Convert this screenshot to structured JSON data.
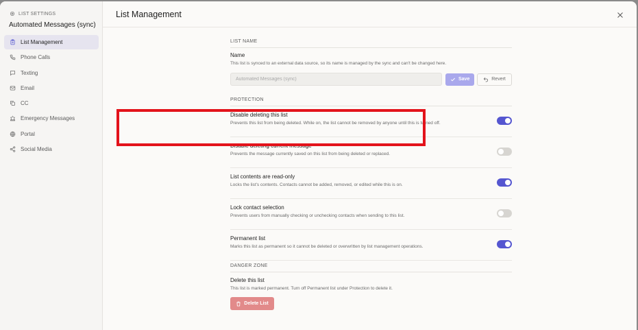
{
  "sidebar": {
    "eyebrow": "LIST SETTINGS",
    "title": "Automated Messages (sync)",
    "items": [
      {
        "label": "List Management",
        "icon": "list-clipboard-icon",
        "active": true
      },
      {
        "label": "Phone Calls",
        "icon": "phone-icon"
      },
      {
        "label": "Texting",
        "icon": "message-icon"
      },
      {
        "label": "Email",
        "icon": "mail-icon"
      },
      {
        "label": "CC",
        "icon": "copy-icon"
      },
      {
        "label": "Emergency Messages",
        "icon": "siren-icon"
      },
      {
        "label": "Portal",
        "icon": "globe-icon"
      },
      {
        "label": "Social Media",
        "icon": "share-icon"
      }
    ]
  },
  "header": {
    "title": "List Management"
  },
  "list_name": {
    "section": "LIST NAME",
    "title": "Name",
    "desc": "This list is synced to an external data source, so its name is managed by the sync and can't be changed here.",
    "input_value": "Automated Messages (sync)",
    "save_label": "Save",
    "revert_label": "Revert"
  },
  "protection": {
    "section": "PROTECTION",
    "rows": [
      {
        "title": "Disable deleting this list",
        "desc": "Prevents this list from being deleted. While on, the list cannot be removed by anyone until this is turned off.",
        "on": true
      },
      {
        "title": "Disable deleting current message",
        "desc": "Prevents the message currently saved on this list from being deleted or replaced.",
        "on": false
      },
      {
        "title": "List contents are read-only",
        "desc": "Locks the list's contents. Contacts cannot be added, removed, or edited while this is on.",
        "on": true
      },
      {
        "title": "Lock contact selection",
        "desc": "Prevents users from manually checking or unchecking contacts when sending to this list.",
        "on": false
      },
      {
        "title": "Permanent list",
        "desc": "Marks this list as permanent so it cannot be deleted or overwritten by list management operations.",
        "on": true
      }
    ]
  },
  "danger": {
    "section": "DANGER ZONE",
    "title": "Delete this list",
    "desc": "This list is marked permanent. Turn off Permanent list under Protection to delete it.",
    "button_label": "Delete List"
  },
  "colors": {
    "accent": "#5556d0",
    "highlight": "#e3131b",
    "danger": "#e28a8a"
  }
}
